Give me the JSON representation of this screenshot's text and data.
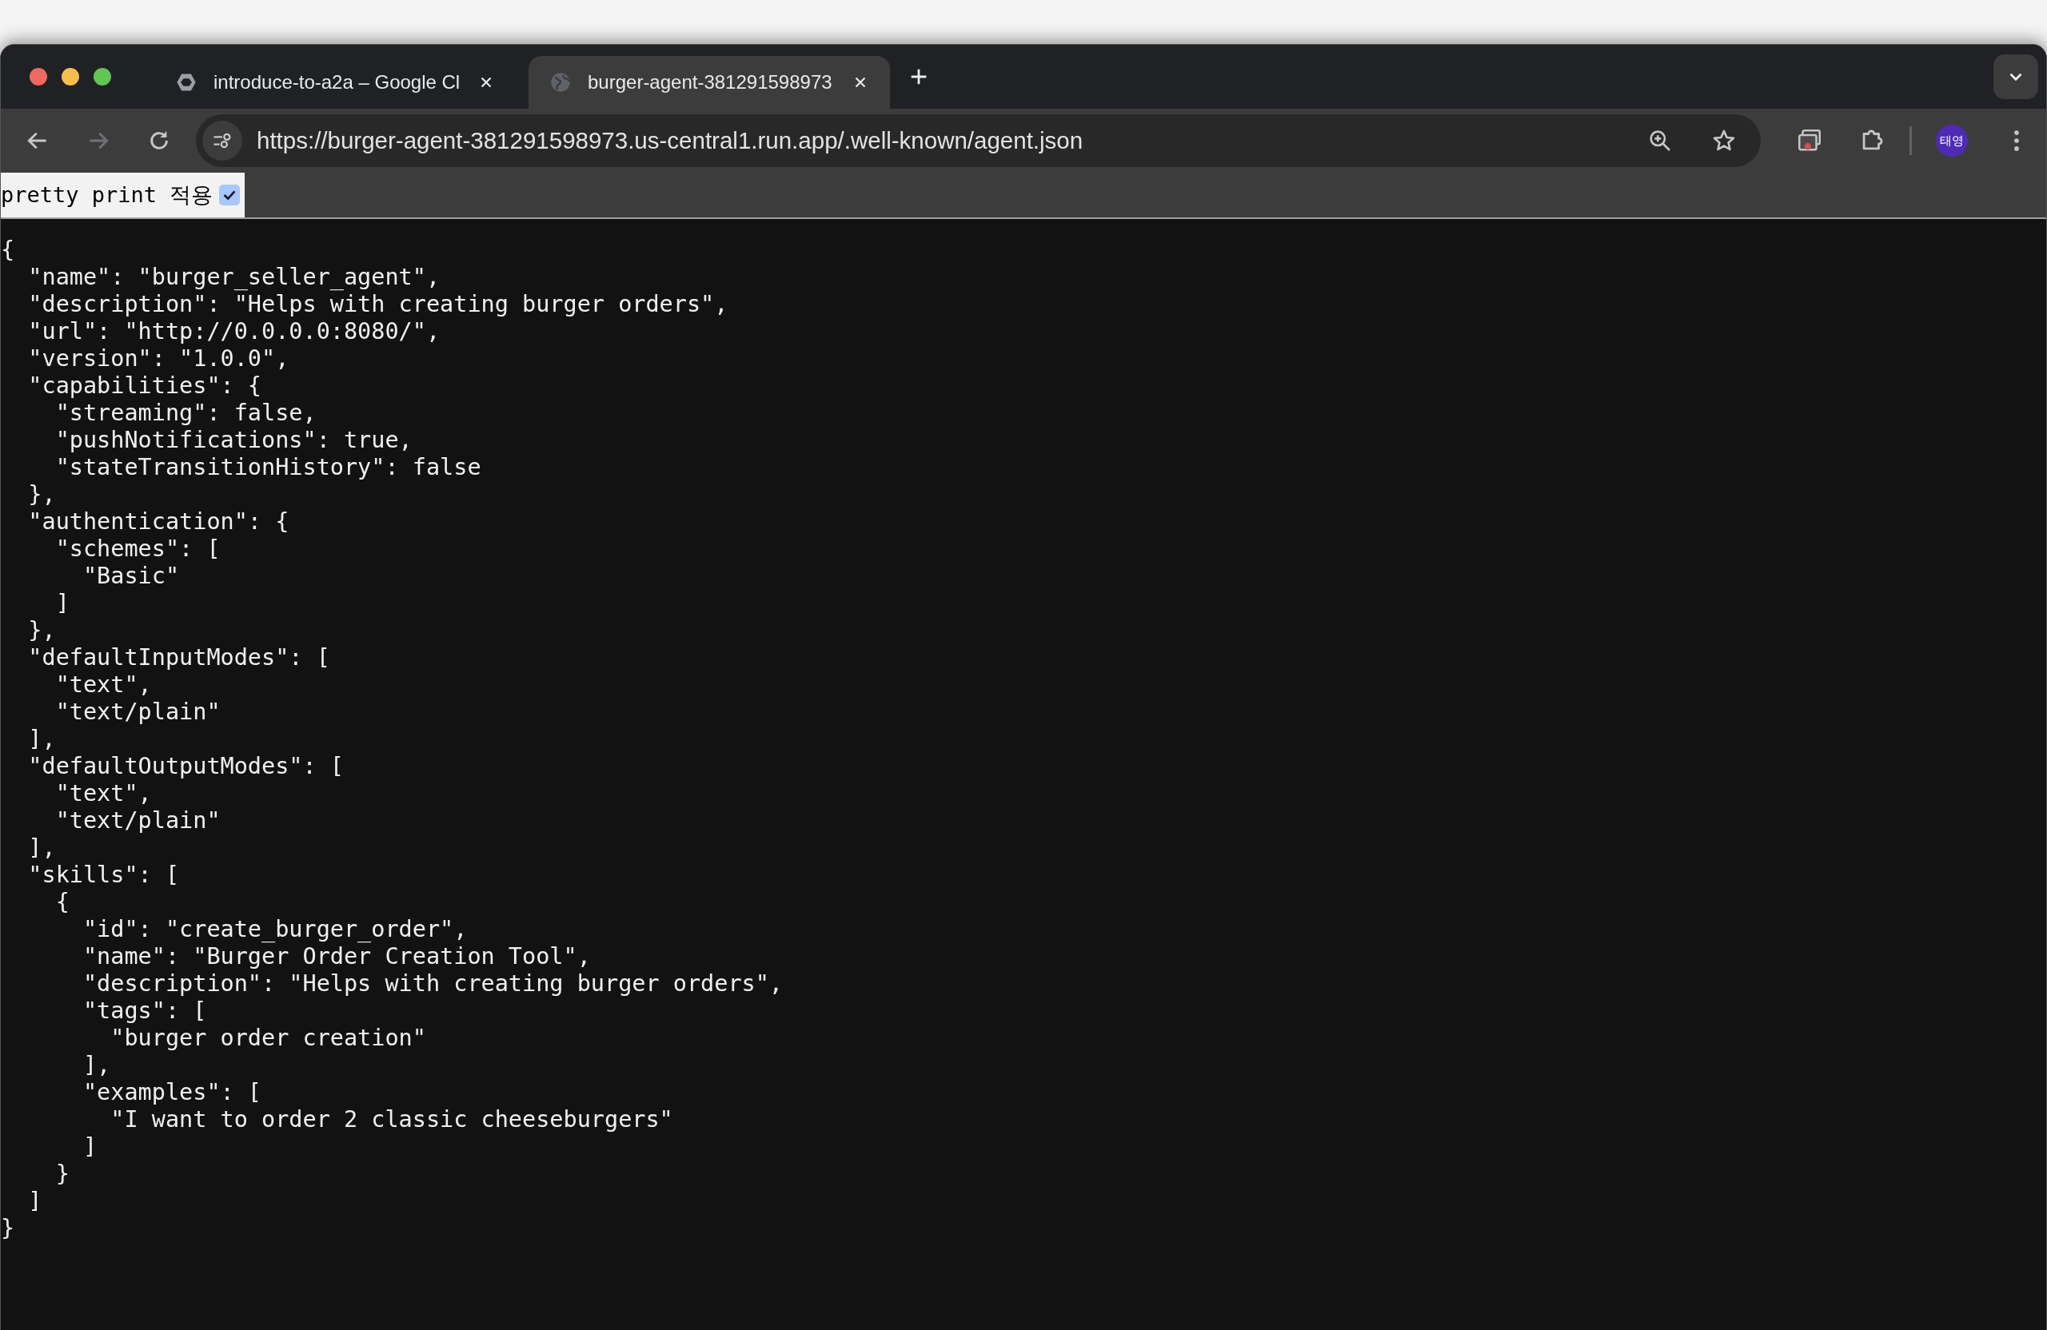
{
  "tabs": [
    {
      "kind": "hexagon",
      "title": "introduce-to-a2a – Google Cl",
      "selected": false
    },
    {
      "kind": "globe",
      "title": "burger-agent-381291598973",
      "selected": true
    }
  ],
  "toolbar": {
    "forward_disabled": true,
    "url": "https://burger-agent-381291598973.us-central1.run.app/.well-known/agent.json",
    "profile_initials": "태영"
  },
  "pretty_print": {
    "label": "pretty print 적용",
    "checked": true
  },
  "code_lines": [
    "{",
    "  \"name\": \"burger_seller_agent\",",
    "  \"description\": \"Helps with creating burger orders\",",
    "  \"url\": \"http://0.0.0.0:8080/\",",
    "  \"version\": \"1.0.0\",",
    "  \"capabilities\": {",
    "    \"streaming\": false,",
    "    \"pushNotifications\": true,",
    "    \"stateTransitionHistory\": false",
    "  },",
    "  \"authentication\": {",
    "    \"schemes\": [",
    "      \"Basic\"",
    "    ]",
    "  },",
    "  \"defaultInputModes\": [",
    "    \"text\",",
    "    \"text/plain\"",
    "  ],",
    "  \"defaultOutputModes\": [",
    "    \"text\",",
    "    \"text/plain\"",
    "  ],",
    "  \"skills\": [",
    "    {",
    "      \"id\": \"create_burger_order\",",
    "      \"name\": \"Burger Order Creation Tool\",",
    "      \"description\": \"Helps with creating burger orders\",",
    "      \"tags\": [",
    "        \"burger order creation\"",
    "      ],",
    "      \"examples\": [",
    "        \"I want to order 2 classic cheeseburgers\"",
    "      ]",
    "    }",
    "  ]",
    "}"
  ]
}
